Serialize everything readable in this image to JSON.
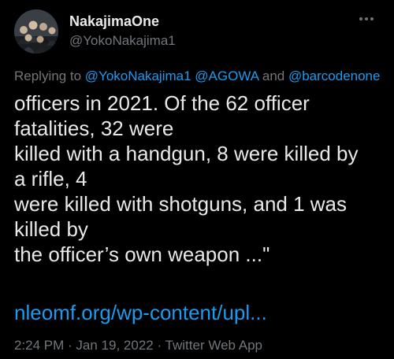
{
  "author": {
    "display_name": "NakajimaOne",
    "handle": "@YokoNakajima1",
    "avatar_icon": "group-photo-avatar"
  },
  "more_icon": "more-dots-icon",
  "replying": {
    "prefix": "Replying to ",
    "mention1": "@YokoNakajima1",
    "sep1": " ",
    "mention2": "@AGOWA",
    "sep2": " and ",
    "mention3": "@barcodenone"
  },
  "body_lines": [
    "officers in 2021. Of the 62 officer",
    "fatalities, 32 were",
    "killed with a handgun, 8 were killed by",
    "a rifle, 4",
    "were killed with shotguns, and 1 was",
    "killed by",
    "the officer’s own weapon ...\""
  ],
  "link_text": "nleomf.org/wp-content/upl...",
  "meta": {
    "time": "2:24 PM",
    "sep1": " · ",
    "date": "Jan 19, 2022",
    "sep2": " · ",
    "source": "Twitter Web App"
  },
  "colors": {
    "background": "#000000",
    "text": "#e7e9ea",
    "secondary": "#71767b",
    "accent": "#1d9bf0"
  }
}
